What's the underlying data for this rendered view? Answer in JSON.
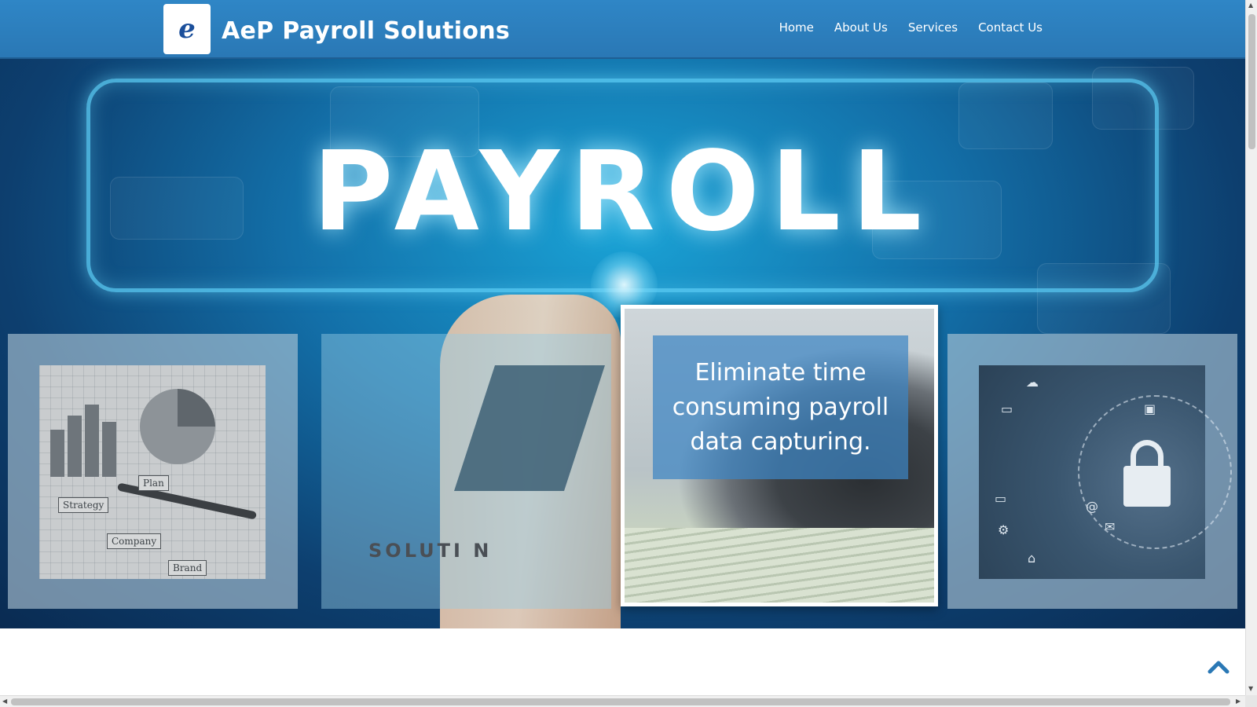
{
  "header": {
    "logo_letter": "e",
    "brand": "AeP Payroll Solutions",
    "nav": [
      {
        "label": "Home"
      },
      {
        "label": "About Us"
      },
      {
        "label": "Services"
      },
      {
        "label": "Contact Us"
      }
    ]
  },
  "hero": {
    "headline": "PAYROLL",
    "solution_text": "SOLUTI N",
    "caption": "Eliminate time consuming payroll data capturing.",
    "strategy_tags": [
      "Strategy",
      "Plan",
      "Company",
      "Brand"
    ]
  },
  "colors": {
    "header": "#2f86c6",
    "accent": "#2a78b5",
    "caption_bg": "#3d85c4"
  },
  "icons": {
    "back_to_top": "chevron-up-icon",
    "lock": "lock-icon"
  }
}
